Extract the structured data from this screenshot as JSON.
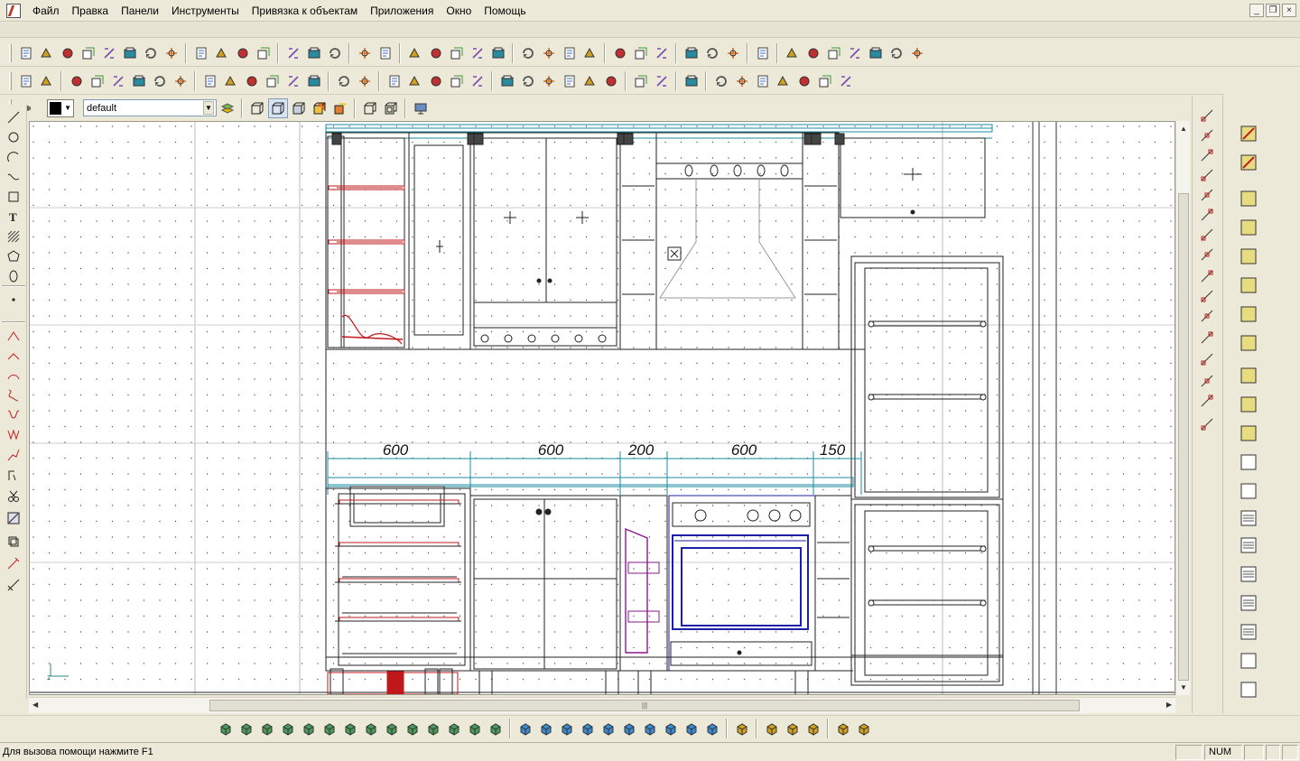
{
  "menu": {
    "items": [
      "Файл",
      "Правка",
      "Панели",
      "Инструменты",
      "Привязка к объектам",
      "Приложения",
      "Окно",
      "Помощь"
    ]
  },
  "window_controls": {
    "minimize": "_",
    "restore": "❐",
    "close": "×"
  },
  "layer_bar": {
    "current_layer": "default",
    "current_color": "#000000"
  },
  "drawing": {
    "dimensions": [
      "600",
      "600",
      "200",
      "600",
      "150"
    ]
  },
  "statusbar": {
    "help_text": "Для вызова помощи нажмите F1",
    "num_indicator": "NUM"
  },
  "toolbar_icons": {
    "row1": [
      "new-icon",
      "new-from-template-icon",
      "open-image-icon",
      "open-icon",
      "save-icon",
      "print-icon",
      "print-preview-icon",
      "export-icon",
      "select-icon",
      "cut-icon",
      "trim-icon",
      "eraser-icon",
      "copy-icon",
      "paste-icon",
      "purge-icon",
      "undo-icon",
      "redo-icon",
      "move-icon",
      "rotate-icon",
      "mirror-icon",
      "snap-point-icon",
      "snap-end-icon",
      "box-icon",
      "box-2-icon",
      "box-3-icon",
      "intersect-icon",
      "line-icon",
      "line-2-icon",
      "arc-icon",
      "circle-arc-icon",
      "center-icon",
      "target-icon",
      "plus-icon",
      "pan-hand-icon",
      "zoom-in-icon",
      "orbit-icon",
      "refresh-icon",
      "stop-icon",
      "hammer-icon",
      "cog-icon"
    ],
    "row2": [
      "zoom-icon",
      "zoom-window-icon",
      "view-3d-icon",
      "view-front-icon",
      "view-side-icon",
      "view-top-icon",
      "view-iso-icon",
      "view-back-icon",
      "camera-icon",
      "walk-icon",
      "dimension-icon",
      "render-icon",
      "pencil-icon",
      "light-icon",
      "layers-icon",
      "grid-icon",
      "ortho-icon",
      "measure-icon",
      "image-icon",
      "paint-icon",
      "brush-icon",
      "align-icon",
      "stack-icon",
      "distribute-icon",
      "group-icon",
      "ungroup-icon",
      "frame-icon",
      "array-icon",
      "explode-icon",
      "properties-icon",
      "material-icon",
      "texture-icon",
      "layer-list-icon",
      "layer-edit-icon",
      "layer-move-icon",
      "layer-copy-icon",
      "measure-text-icon"
    ]
  },
  "colors": {
    "ui_bg": "#ece9d8",
    "canvas_bg": "#ffffff",
    "dimension_color": "#1a8aa0",
    "accent_red": "#c0171b",
    "accent_blue": "#1f1fa5",
    "accent_purple": "#8a1a8a"
  }
}
